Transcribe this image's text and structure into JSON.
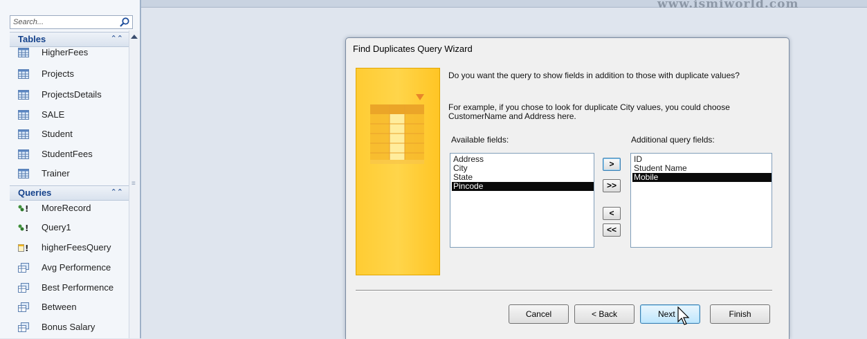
{
  "navigation_pane": {
    "search_placeholder": "Search...",
    "groups": [
      {
        "title": "Tables",
        "items": [
          "HigherFees",
          "Projects",
          "ProjectsDetails",
          "SALE",
          "Student",
          "StudentFees",
          "Trainer"
        ]
      },
      {
        "title": "Queries",
        "items": [
          "MoreRecord",
          "Query1",
          "higherFeesQuery",
          "Avg Performence",
          "Best Performence",
          "Between",
          "Bonus Salary"
        ]
      }
    ]
  },
  "watermark": {
    "url": "www.ismiworld.com"
  },
  "dialog": {
    "title": "Find Duplicates Query Wizard",
    "question": "Do you want the query to show fields in addition to those with duplicate values?",
    "example_line1": "For example, if you chose to look for duplicate City values, you could choose",
    "example_line2": "CustomerName and Address here.",
    "available_label": "Available fields:",
    "additional_label": "Additional query fields:",
    "available_fields": [
      "Address",
      "City",
      "State",
      "Pincode"
    ],
    "available_selected": "Pincode",
    "additional_fields": [
      "ID",
      "Student Name",
      "Mobile"
    ],
    "additional_selected": "Mobile",
    "move_buttons": {
      "add_one": ">",
      "add_all": ">>",
      "remove_one": "<",
      "remove_all": "<<"
    },
    "buttons": {
      "cancel": "Cancel",
      "back": "< Back",
      "next": "Next >",
      "finish": "Finish"
    }
  },
  "colors": {
    "accent": "#15428b",
    "selection": "#0a0a0a",
    "banner": "#ffcc33"
  }
}
